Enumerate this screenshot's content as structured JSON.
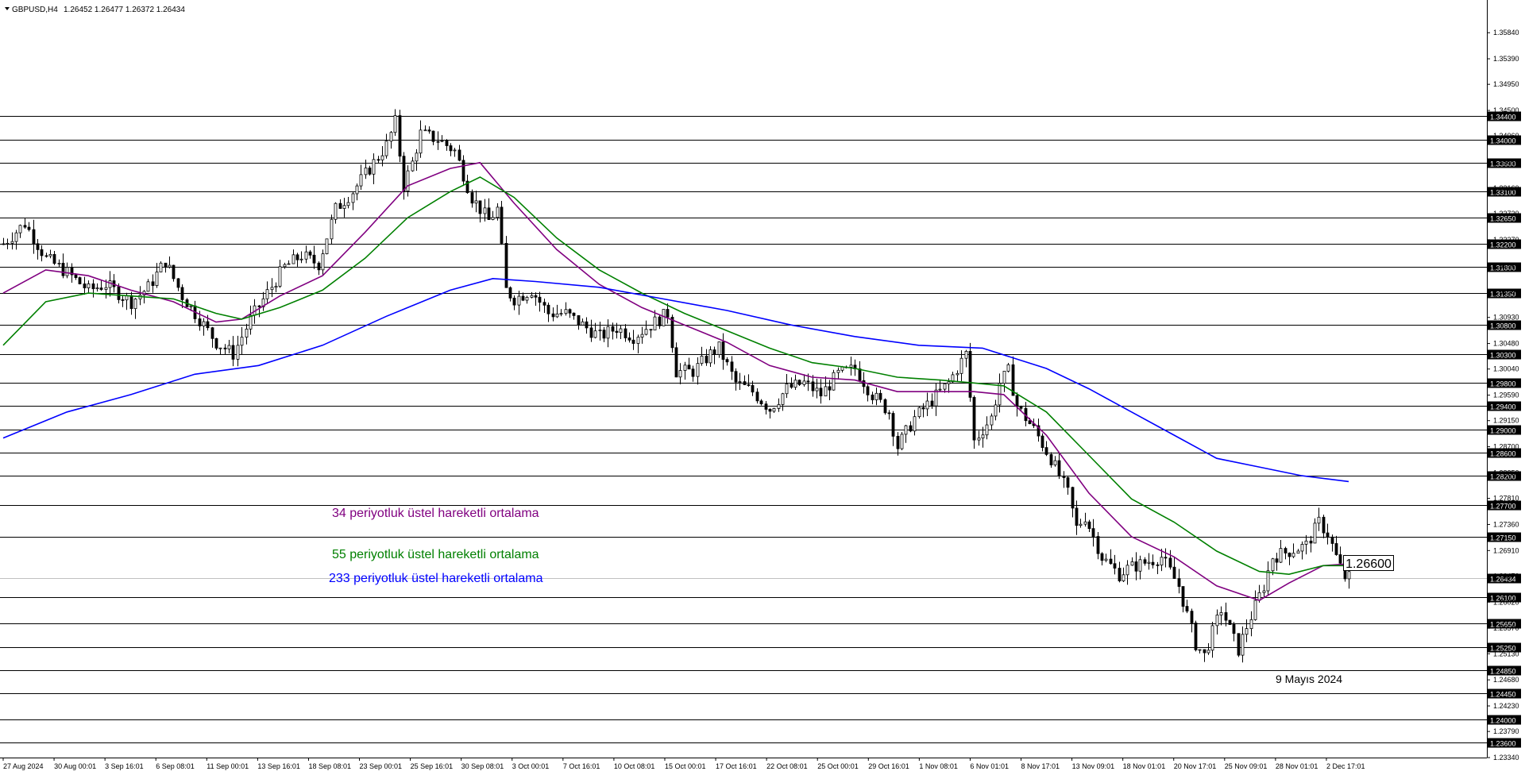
{
  "header": {
    "symbol_text": "GBPUSD,H4",
    "ohlc_text": "1.26452 1.26477 1.26372 1.26434"
  },
  "annotations": {
    "ema34": "34 periyotluk üstel hareketli ortalama",
    "ema55": "55 periyotluk üstel hareketli ortalama",
    "ema233": "233 periyotluk üstel hareketli ortalama",
    "date_note": "9 Mayıs 2024",
    "price_box": "1.26600"
  },
  "colors": {
    "ema34": "#800080",
    "ema55": "#008000",
    "ema233": "#0000ff",
    "candle": "#000000",
    "level_line": "#000000",
    "bid_line": "#c0c0c0"
  },
  "chart_data": {
    "type": "candlestick",
    "symbol": "GBPUSD",
    "timeframe": "H4",
    "ylim": [
      1.2334,
      1.3613
    ],
    "x_ticks": [
      "27 Aug 2024",
      "30 Aug 00:01",
      "3 Sep 16:01",
      "6 Sep 08:01",
      "11 Sep 00:01",
      "13 Sep 16:01",
      "18 Sep 08:01",
      "23 Sep 00:01",
      "25 Sep 16:01",
      "30 Sep 08:01",
      "3 Oct 00:01",
      "7 Oct 16:01",
      "10 Oct 08:01",
      "15 Oct 00:01",
      "17 Oct 16:01",
      "22 Oct 08:01",
      "25 Oct 00:01",
      "29 Oct 16:01",
      "1 Nov 08:01",
      "6 Nov 01:01",
      "8 Nov 17:01",
      "13 Nov 09:01",
      "18 Nov 01:01",
      "20 Nov 17:01",
      "25 Nov 09:01",
      "28 Nov 01:01",
      "2 Dec 17:01"
    ],
    "y_ticks": [
      "1.35840",
      "1.35390",
      "1.34950",
      "1.34500",
      "1.34060",
      "1.33610",
      "1.33160",
      "1.32720",
      "1.32270",
      "1.31820",
      "1.31380",
      "1.30930",
      "1.30480",
      "1.30040",
      "1.29590",
      "1.29150",
      "1.28700",
      "1.28250",
      "1.27810",
      "1.27360",
      "1.26910",
      "1.26470",
      "1.26020",
      "1.25570",
      "1.25130",
      "1.24680",
      "1.24230",
      "1.23790",
      "1.23340"
    ],
    "horizontal_levels": [
      "1.34400",
      "1.34000",
      "1.33600",
      "1.33100",
      "1.32650",
      "1.32200",
      "1.31800",
      "1.31350",
      "1.30800",
      "1.30300",
      "1.29800",
      "1.29400",
      "1.29000",
      "1.28600",
      "1.28200",
      "1.27700",
      "1.27150",
      "1.26100",
      "1.25650",
      "1.25250",
      "1.24850",
      "1.24450",
      "1.24000",
      "1.23600"
    ],
    "current_price": "1.26434",
    "price_path": [
      [
        0,
        1.322
      ],
      [
        5,
        1.3255
      ],
      [
        10,
        1.3195
      ],
      [
        15,
        1.317
      ],
      [
        20,
        1.314
      ],
      [
        24,
        1.315
      ],
      [
        30,
        1.312
      ],
      [
        34,
        1.3145
      ],
      [
        38,
        1.319
      ],
      [
        42,
        1.313
      ],
      [
        46,
        1.309
      ],
      [
        50,
        1.305
      ],
      [
        54,
        1.303
      ],
      [
        58,
        1.309
      ],
      [
        62,
        1.3135
      ],
      [
        66,
        1.318
      ],
      [
        70,
        1.32
      ],
      [
        74,
        1.3185
      ],
      [
        78,
        1.328
      ],
      [
        82,
        1.331
      ],
      [
        86,
        1.335
      ],
      [
        90,
        1.339
      ],
      [
        92,
        1.343
      ],
      [
        94,
        1.332
      ],
      [
        96,
        1.336
      ],
      [
        98,
        1.341
      ],
      [
        102,
        1.34
      ],
      [
        106,
        1.338
      ],
      [
        110,
        1.33
      ],
      [
        114,
        1.326
      ],
      [
        116,
        1.328
      ],
      [
        118,
        1.314
      ],
      [
        120,
        1.3125
      ],
      [
        124,
        1.314
      ],
      [
        128,
        1.31
      ],
      [
        132,
        1.31
      ],
      [
        136,
        1.308
      ],
      [
        140,
        1.306
      ],
      [
        144,
        1.3075
      ],
      [
        148,
        1.306
      ],
      [
        152,
        1.308
      ],
      [
        156,
        1.31
      ],
      [
        158,
        1.3
      ],
      [
        162,
        1.3
      ],
      [
        166,
        1.303
      ],
      [
        168,
        1.304
      ],
      [
        172,
        1.298
      ],
      [
        176,
        1.2965
      ],
      [
        180,
        1.2935
      ],
      [
        184,
        1.297
      ],
      [
        188,
        1.298
      ],
      [
        192,
        1.296
      ],
      [
        196,
        1.2995
      ],
      [
        200,
        1.3005
      ],
      [
        204,
        1.296
      ],
      [
        208,
        1.293
      ],
      [
        210,
        1.287
      ],
      [
        214,
        1.292
      ],
      [
        218,
        1.295
      ],
      [
        222,
        1.298
      ],
      [
        226,
        1.303
      ],
      [
        228,
        1.288
      ],
      [
        232,
        1.292
      ],
      [
        234,
        1.298
      ],
      [
        236,
        1.3
      ],
      [
        238,
        1.294
      ],
      [
        242,
        1.29
      ],
      [
        246,
        1.285
      ],
      [
        250,
        1.279
      ],
      [
        252,
        1.273
      ],
      [
        254,
        1.275
      ],
      [
        258,
        1.268
      ],
      [
        262,
        1.265
      ],
      [
        264,
        1.266
      ],
      [
        268,
        1.267
      ],
      [
        272,
        1.268
      ],
      [
        276,
        1.263
      ],
      [
        278,
        1.258
      ],
      [
        280,
        1.253
      ],
      [
        282,
        1.251
      ],
      [
        286,
        1.259
      ],
      [
        290,
        1.252
      ],
      [
        292,
        1.256
      ],
      [
        296,
        1.263
      ],
      [
        298,
        1.268
      ],
      [
        302,
        1.269
      ],
      [
        306,
        1.27
      ],
      [
        309,
        1.274
      ],
      [
        311,
        1.272
      ],
      [
        313,
        1.268
      ],
      [
        315,
        1.2645
      ]
    ],
    "series": [
      {
        "name": "34 periyotluk üstel hareketli ortalama",
        "color": "#800080",
        "points": [
          [
            0,
            1.3135
          ],
          [
            10,
            1.3175
          ],
          [
            20,
            1.3165
          ],
          [
            30,
            1.314
          ],
          [
            40,
            1.312
          ],
          [
            50,
            1.3085
          ],
          [
            56,
            1.309
          ],
          [
            65,
            1.313
          ],
          [
            75,
            1.3165
          ],
          [
            85,
            1.324
          ],
          [
            95,
            1.332
          ],
          [
            105,
            1.335
          ],
          [
            112,
            1.336
          ],
          [
            120,
            1.329
          ],
          [
            130,
            1.321
          ],
          [
            140,
            1.315
          ],
          [
            150,
            1.311
          ],
          [
            160,
            1.308
          ],
          [
            170,
            1.305
          ],
          [
            180,
            1.301
          ],
          [
            190,
            1.299
          ],
          [
            200,
            1.2985
          ],
          [
            210,
            1.2965
          ],
          [
            220,
            1.2965
          ],
          [
            228,
            1.2965
          ],
          [
            235,
            1.296
          ],
          [
            245,
            1.289
          ],
          [
            255,
            1.279
          ],
          [
            265,
            1.2715
          ],
          [
            275,
            1.268
          ],
          [
            285,
            1.263
          ],
          [
            295,
            1.2605
          ],
          [
            302,
            1.2635
          ],
          [
            310,
            1.2665
          ],
          [
            316,
            1.2668
          ]
        ]
      },
      {
        "name": "55 periyotluk üstel hareketli ortalama",
        "color": "#008000",
        "points": [
          [
            0,
            1.3045
          ],
          [
            10,
            1.312
          ],
          [
            20,
            1.3135
          ],
          [
            30,
            1.313
          ],
          [
            40,
            1.3125
          ],
          [
            50,
            1.31
          ],
          [
            56,
            1.309
          ],
          [
            65,
            1.311
          ],
          [
            75,
            1.314
          ],
          [
            85,
            1.3195
          ],
          [
            95,
            1.3265
          ],
          [
            105,
            1.331
          ],
          [
            112,
            1.3335
          ],
          [
            120,
            1.33
          ],
          [
            130,
            1.323
          ],
          [
            140,
            1.3175
          ],
          [
            150,
            1.3135
          ],
          [
            160,
            1.31
          ],
          [
            170,
            1.307
          ],
          [
            180,
            1.304
          ],
          [
            190,
            1.3015
          ],
          [
            200,
            1.3005
          ],
          [
            210,
            1.299
          ],
          [
            220,
            1.2985
          ],
          [
            228,
            1.298
          ],
          [
            235,
            1.2975
          ],
          [
            245,
            1.293
          ],
          [
            255,
            1.2855
          ],
          [
            265,
            1.278
          ],
          [
            275,
            1.274
          ],
          [
            285,
            1.269
          ],
          [
            295,
            1.2655
          ],
          [
            302,
            1.265
          ],
          [
            310,
            1.2665
          ],
          [
            316,
            1.2665
          ]
        ]
      },
      {
        "name": "233 periyotluk üstel hareketli ortalama",
        "color": "#0000ff",
        "points": [
          [
            0,
            1.2885
          ],
          [
            15,
            1.293
          ],
          [
            30,
            1.296
          ],
          [
            45,
            1.2995
          ],
          [
            60,
            1.301
          ],
          [
            75,
            1.3045
          ],
          [
            90,
            1.3095
          ],
          [
            105,
            1.314
          ],
          [
            115,
            1.316
          ],
          [
            125,
            1.3155
          ],
          [
            140,
            1.3145
          ],
          [
            155,
            1.3125
          ],
          [
            170,
            1.3105
          ],
          [
            185,
            1.308
          ],
          [
            200,
            1.306
          ],
          [
            215,
            1.3045
          ],
          [
            230,
            1.304
          ],
          [
            245,
            1.3005
          ],
          [
            255,
            1.297
          ],
          [
            265,
            1.293
          ],
          [
            275,
            1.289
          ],
          [
            285,
            1.285
          ],
          [
            295,
            1.2835
          ],
          [
            305,
            1.282
          ],
          [
            316,
            1.281
          ]
        ]
      }
    ]
  }
}
